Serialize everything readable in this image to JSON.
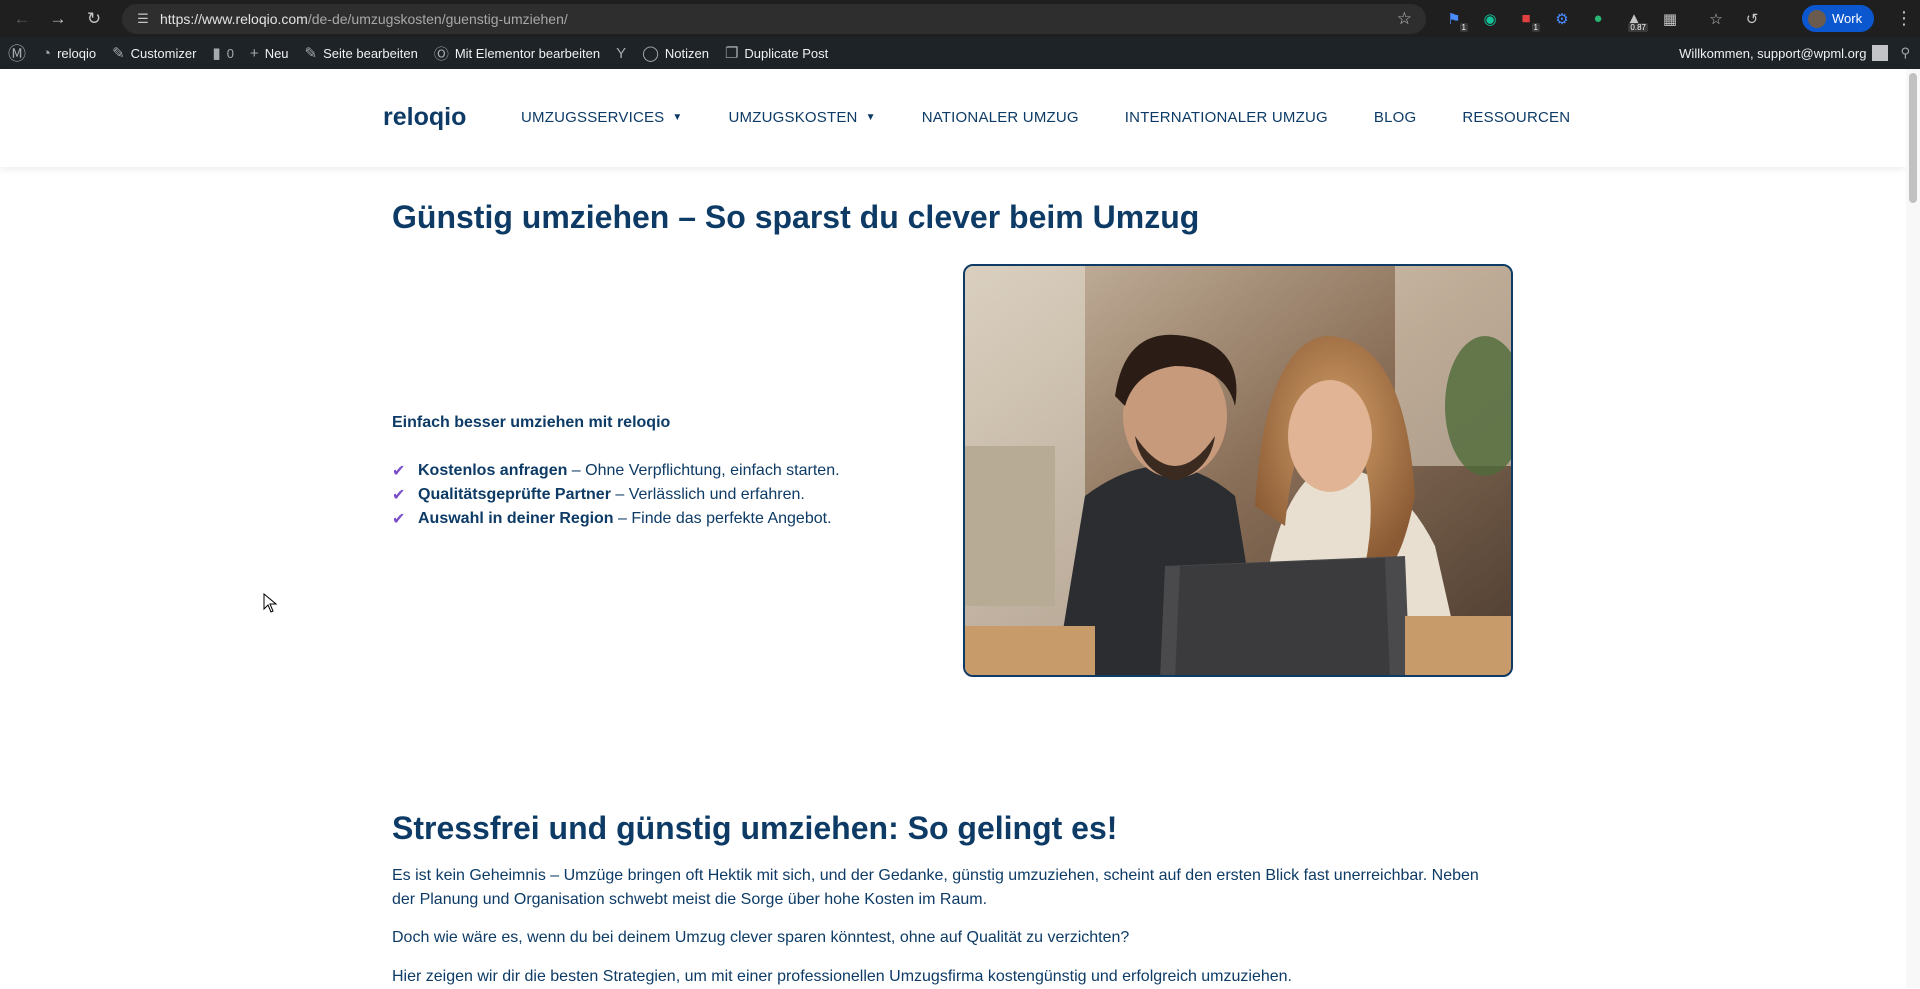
{
  "browser": {
    "url_host": "https://www.reloqio.com",
    "url_path": "/de-de/umzugskosten/guenstig-umziehen/",
    "profile_label": "Work",
    "ext_badges": [
      "1",
      "1",
      "0.87"
    ]
  },
  "adminbar": {
    "site_name": "reloqio",
    "customizer": "Customizer",
    "comments_count": "0",
    "new": "Neu",
    "edit_page": "Seite bearbeiten",
    "elementor": "Mit Elementor bearbeiten",
    "notes": "Notizen",
    "duplicate": "Duplicate Post",
    "welcome": "Willkommen, support@wpml.org"
  },
  "header": {
    "logo": "reloqio",
    "menu": [
      {
        "label": "UMZUGSSERVICES",
        "has_caret": true
      },
      {
        "label": "UMZUGSKOSTEN",
        "has_caret": true
      },
      {
        "label": "NATIONALER UMZUG",
        "has_caret": false
      },
      {
        "label": "INTERNATIONALER UMZUG",
        "has_caret": false
      },
      {
        "label": "BLOG",
        "has_caret": false
      },
      {
        "label": "RESSOURCEN",
        "has_caret": false
      }
    ]
  },
  "hero": {
    "title": "Günstig umziehen – So sparst du clever beim Umzug",
    "intro": "Einfach besser umziehen mit reloqio",
    "checks": [
      {
        "strong": "Kostenlos anfragen",
        "rest": " – Ohne Verpflichtung, einfach starten."
      },
      {
        "strong": "Qualitätsgeprüfte Partner",
        "rest": " – Verlässlich und erfahren."
      },
      {
        "strong": "Auswahl in deiner Region",
        "rest": " – Finde das perfekte Angebot."
      }
    ]
  },
  "section2": {
    "title": "Stressfrei und günstig umziehen: So gelingt es!",
    "paragraphs": [
      "Es ist kein Geheimnis – Umzüge bringen oft Hektik mit sich, und der Gedanke, günstig umzuziehen, scheint auf den ersten Blick fast unerreichbar. Neben der Planung und Organisation schwebt meist die Sorge über hohe Kosten im Raum.",
      "Doch wie wäre es, wenn du bei deinem Umzug clever sparen könntest, ohne auf Qualität zu verzichten?",
      "Hier zeigen wir dir die besten Strategien, um mit einer professionellen Umzugsfirma kostengünstig und erfolgreich umzuziehen."
    ]
  },
  "colors": {
    "brand": "#0d3b66",
    "check": "#7b4fc9",
    "adminbar": "#1d2327",
    "chrome": "#1f1f1f"
  }
}
